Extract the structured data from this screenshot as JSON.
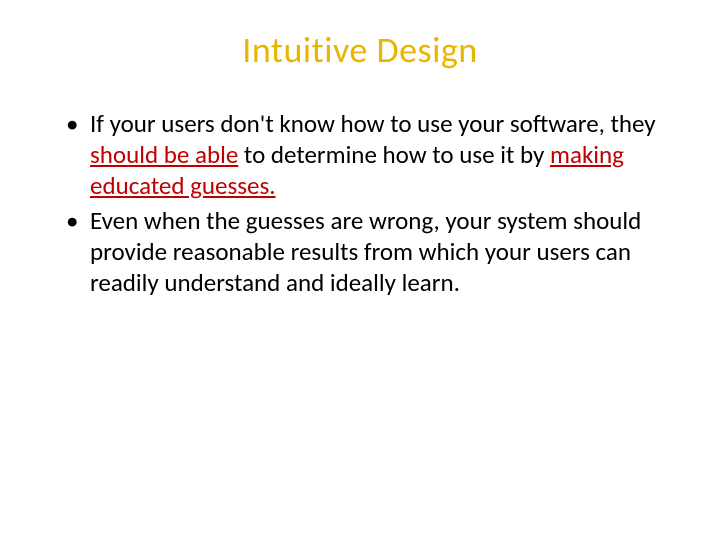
{
  "slide": {
    "title": "Intuitive Design",
    "bullets": [
      {
        "pre": "If your users don't know how to use your software, they ",
        "em1": "should be able",
        "mid": " to determine how to use it by ",
        "em2": "making educated guesses.",
        "post": ""
      },
      {
        "pre": "Even when the guesses are wrong, your system should provide reasonable results from which your users can readily understand and ideally learn.",
        "em1": "",
        "mid": "",
        "em2": "",
        "post": ""
      }
    ]
  }
}
